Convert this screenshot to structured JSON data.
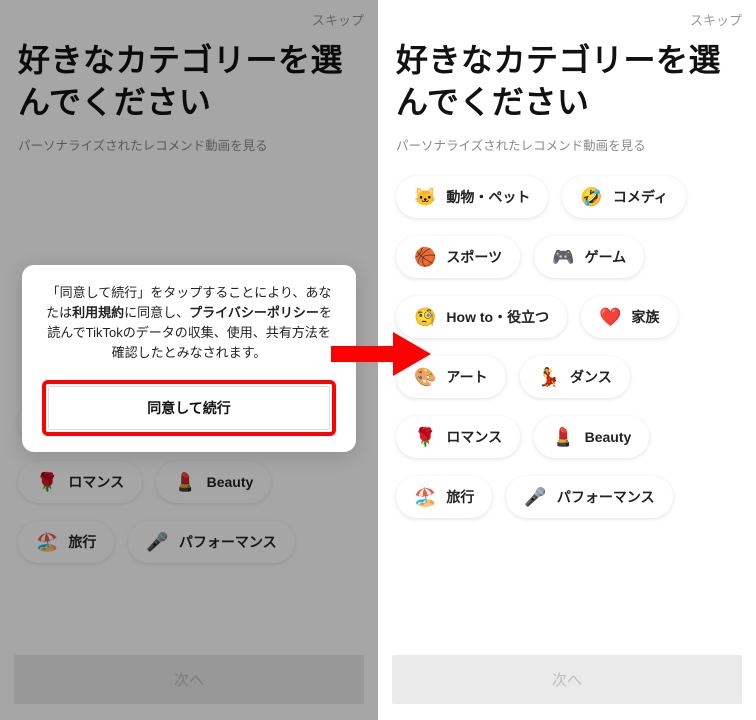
{
  "skip_label": "スキップ",
  "title_text": "好きなカテゴリーを選んでください",
  "subtitle_text": "パーソナライズされたレコメンド動画を見る",
  "next_label": "次へ",
  "dialog": {
    "pre1": "「同意して続行」をタップすることにより、あなたは",
    "terms": "利用規約",
    "mid1": "に同意し、",
    "privacy": "プライバシーポリシー",
    "post1": "を読んでTikTokのデータの収集、使用、共有方法を確認したとみなされます。",
    "button_label": "同意して続行"
  },
  "categories": {
    "animals": {
      "emoji": "🐱",
      "label": "動物・ペット"
    },
    "comedy": {
      "emoji": "🤣",
      "label": "コメディ"
    },
    "sports": {
      "emoji": "🏀",
      "label": "スポーツ"
    },
    "game": {
      "emoji": "🎮",
      "label": "ゲーム"
    },
    "howto": {
      "emoji": "🧐",
      "label": "How to・役立つ"
    },
    "family": {
      "emoji": "❤️",
      "label": "家族"
    },
    "art": {
      "emoji": "🎨",
      "label": "アート"
    },
    "dance": {
      "emoji": "💃",
      "label": "ダンス"
    },
    "romance": {
      "emoji": "🌹",
      "label": "ロマンス"
    },
    "beauty": {
      "emoji": "💄",
      "label": "Beauty"
    },
    "travel": {
      "emoji": "🏖️",
      "label": "旅行"
    },
    "performance": {
      "emoji": "🎤",
      "label": "パフォーマンス"
    }
  },
  "colors": {
    "highlight": "#ff0000",
    "next_bg": "#eaeaea",
    "next_fg": "#bdbdbd"
  }
}
